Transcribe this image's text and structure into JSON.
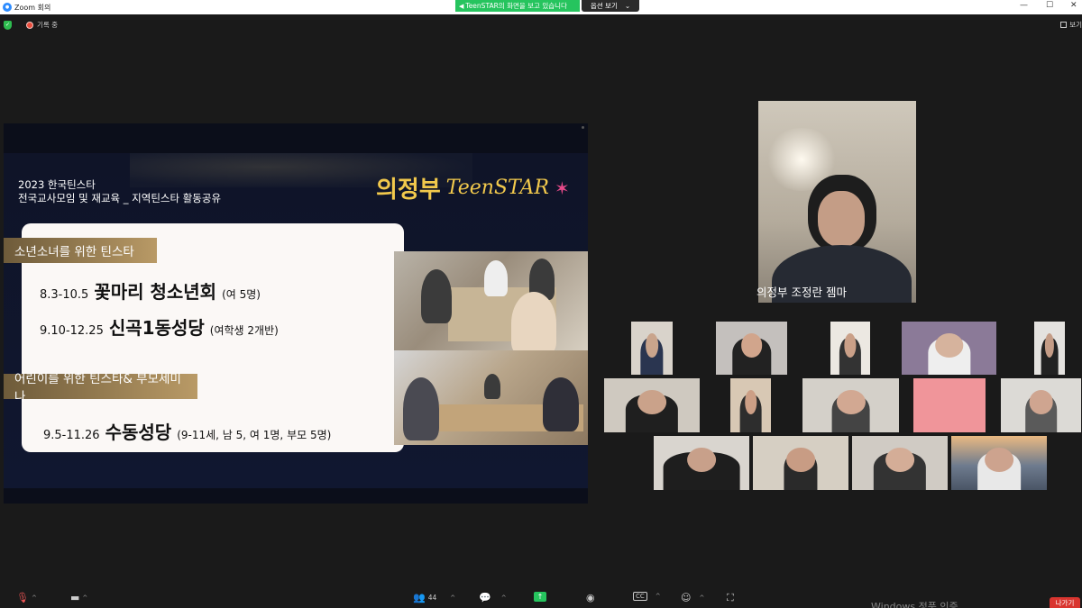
{
  "window": {
    "title": "Zoom 회의",
    "controls": [
      "—",
      "☐",
      "✕"
    ]
  },
  "share_banner": {
    "text": "TeenSTAR의 화면을 보고 있습니다",
    "options_label": "옵션 보기"
  },
  "status": {
    "recording_label": "기록 중",
    "view_label": "보기"
  },
  "slide": {
    "header_line1": "2023 한국틴스타",
    "header_line2": "전국교사모임 및 재교육 _ 지역틴스타 활동공유",
    "brand_korean": "의정부",
    "brand_english": "TeenSTAR",
    "section1": "소년소녀를 위한 틴스타",
    "item1_date": "8.3-10.5",
    "item1_name": "꽃마리 청소년회",
    "item1_note": "(여 5명)",
    "item2_date": "9.10-12.25",
    "item2_name": "신곡1동성당",
    "item2_note": "(여학생 2개반)",
    "section2": "어린이를 위한 틴스타& 부모세미나",
    "item3_date": "9.5-11.26",
    "item3_name": "수동성당",
    "item3_note": "(9-11세, 남 5, 여 1명, 부모 5명)"
  },
  "speaker": {
    "name": "의정부 조정란 젬마"
  },
  "toolbar": {
    "participants_count": "44",
    "leave_label": "나가기"
  },
  "watermark": "Windows 정품 인증",
  "colors": {
    "share_green": "#26c45e",
    "leave_red": "#d9352f",
    "slide_gold": "#f2c94c"
  }
}
